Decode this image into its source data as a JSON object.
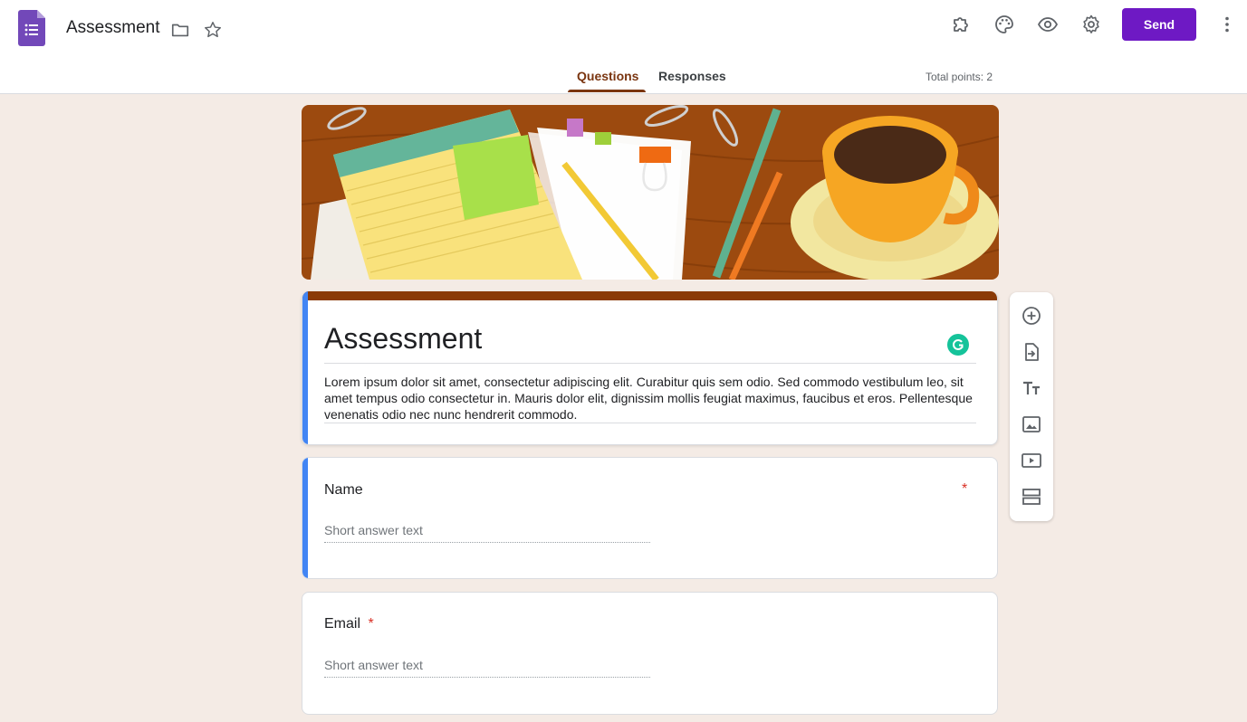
{
  "header": {
    "title": "Assessment",
    "send_label": "Send",
    "tabs": [
      {
        "label": "Questions",
        "active": true
      },
      {
        "label": "Responses",
        "active": false
      }
    ],
    "total_points": "Total points: 2",
    "icons": [
      "forms-logo-icon",
      "folder-icon",
      "star-icon",
      "addon-puzzle-icon",
      "palette-icon",
      "preview-eye-icon",
      "settings-gear-icon",
      "more-vert-icon"
    ]
  },
  "form": {
    "title": "Assessment",
    "description": "Lorem ipsum dolor sit amet, consectetur adipiscing elit. Curabitur quis sem odio. Sed commodo vestibulum leo, sit amet tempus odio consectetur in. Mauris dolor elit, dignissim mollis feugiat maximus, faucibus et eros. Pellentesque venenatis odio nec nunc hendrerit commodo."
  },
  "questions": [
    {
      "label": "Name",
      "required_mark": "*",
      "placeholder": "Short answer text"
    },
    {
      "label": "Email",
      "required_mark": "*",
      "placeholder": "Short answer text"
    }
  ],
  "toolbar": {
    "items": [
      "add-question-icon",
      "import-questions-icon",
      "add-title-icon",
      "add-image-icon",
      "add-video-icon",
      "add-section-icon"
    ]
  },
  "colors": {
    "accent": "#6e19c4",
    "theme": "#8a3a07",
    "background": "#f4ebe5",
    "focus": "#4285f4",
    "required": "#d93025"
  }
}
